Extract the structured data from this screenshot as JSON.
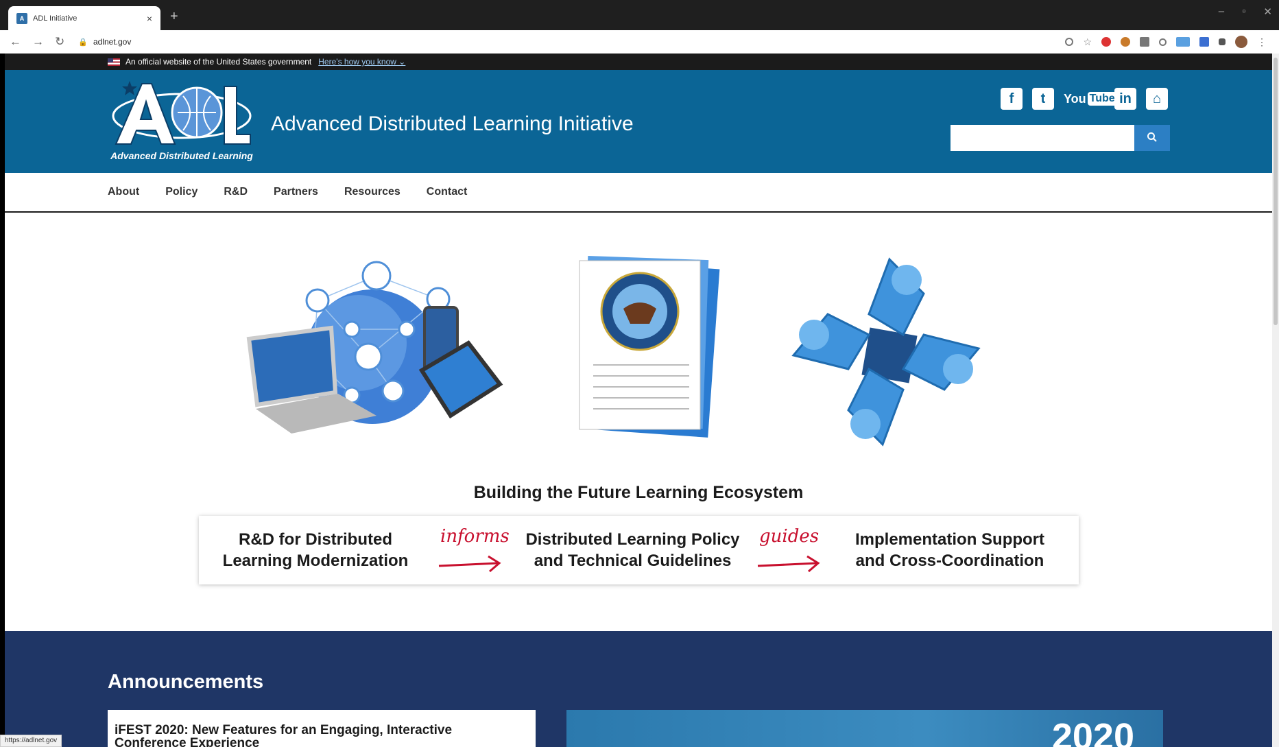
{
  "browser": {
    "tab_title": "ADL Initiative",
    "tab_close": "×",
    "new_tab": "+",
    "url": "adlnet.gov",
    "status_url": "https://adlnet.gov"
  },
  "gov_banner": {
    "text": "An official website of the United States government",
    "link": "Here's how you know ⌄"
  },
  "header": {
    "logo_text": "Advanced Distributed Learning",
    "site_title": "Advanced Distributed Learning Initiative",
    "social": {
      "facebook": "f",
      "twitter": "t",
      "youtube_a": "You",
      "youtube_b": "Tube",
      "linkedin": "in",
      "github": "⌂"
    },
    "search_placeholder": ""
  },
  "nav": [
    "About",
    "Policy",
    "R&D",
    "Partners",
    "Resources",
    "Contact"
  ],
  "hero": {
    "tagline": "Building the Future Learning Ecosystem",
    "flow": {
      "step1": [
        "R&D for Distributed",
        "Learning Modernization"
      ],
      "arrow1": "informs",
      "step2": [
        "Distributed Learning Policy",
        "and Technical Guidelines"
      ],
      "arrow2": "guides",
      "step3": [
        "Implementation Support",
        "and Cross-Coordination"
      ]
    }
  },
  "announcements": {
    "title": "Announcements",
    "card_title_1": "iFEST 2020: New Features for an Engaging, Interactive",
    "card_title_2": "Conference Experience",
    "image_year": "2020"
  },
  "colors": {
    "header_blue": "#0b6596",
    "announcements_bg": "#1f3666",
    "accent_red": "#c8102e",
    "search_button": "#2c7fc4"
  }
}
